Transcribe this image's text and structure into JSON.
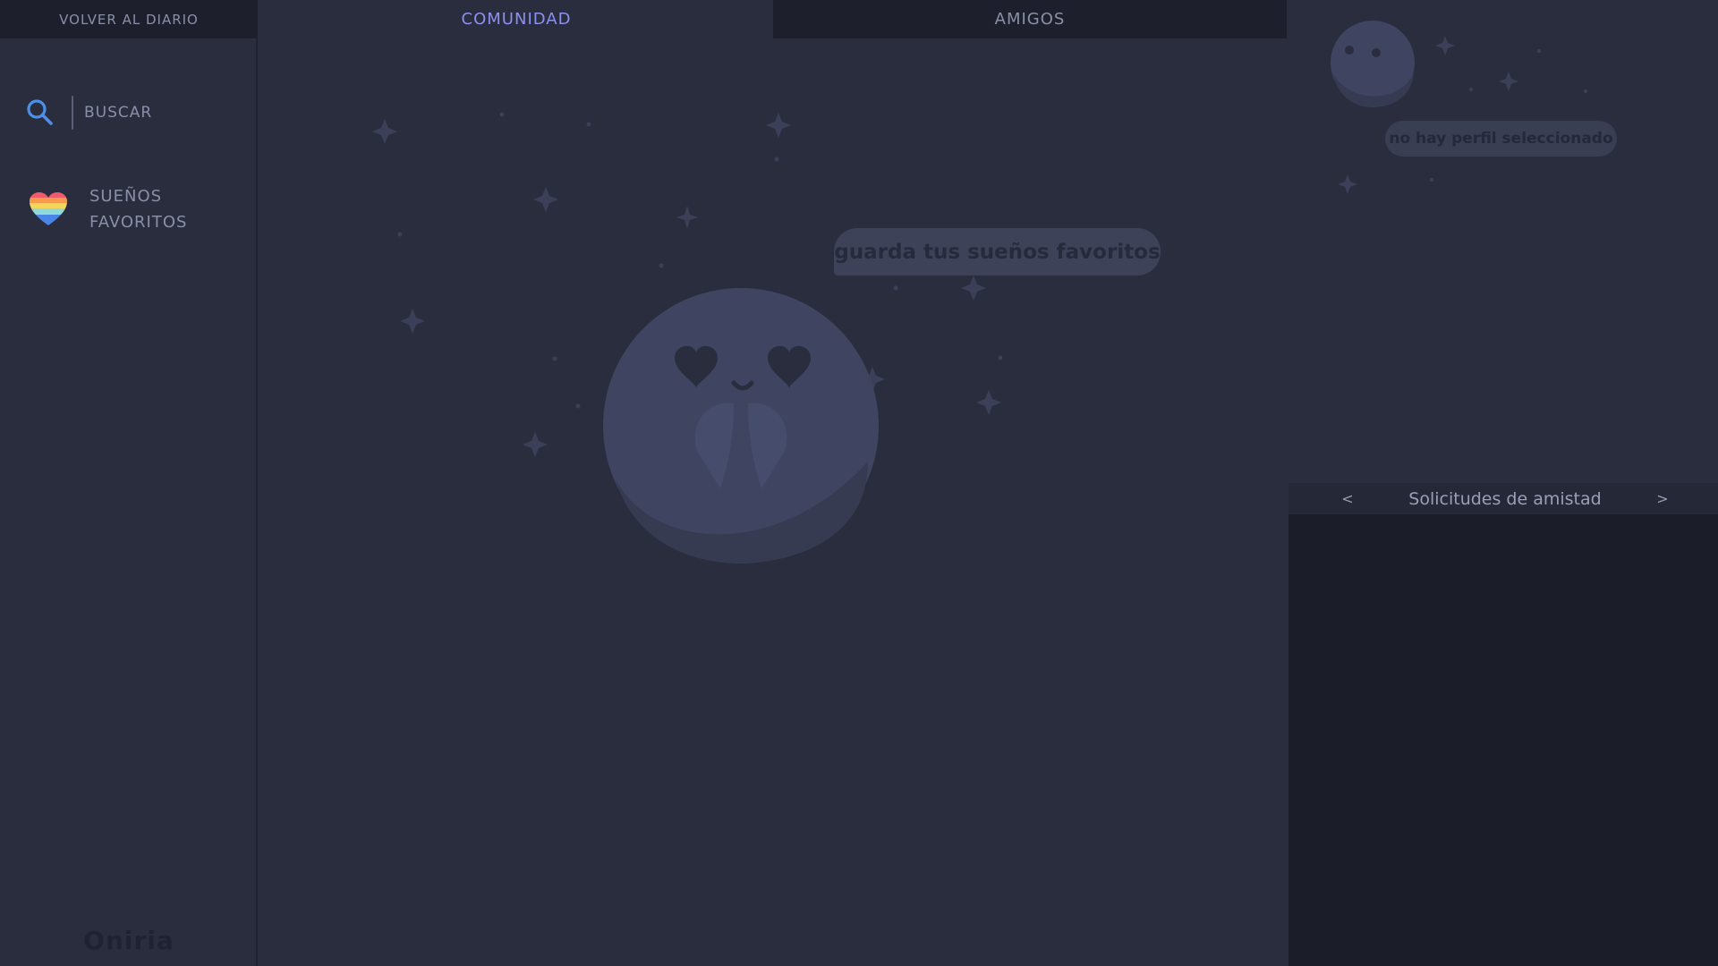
{
  "sidebar": {
    "back_label": "VOLVER AL DIARIO",
    "search_placeholder": "BUSCAR",
    "search_icon": "search-icon",
    "favorites_label": "SUEÑOS FAVORITOS",
    "favorites_icon": "rainbow-heart-icon",
    "brand": "Oniria"
  },
  "tabs": [
    {
      "label": "COMUNIDAD",
      "active": true
    },
    {
      "label": "AMIGOS",
      "active": false
    }
  ],
  "main": {
    "speech_bubble": "guarda tus sueños favoritos",
    "mascot_icon": "moon-mascot-icon"
  },
  "right_panel": {
    "profile_status": "no hay perfil seleccionado",
    "requests_title": "Solicitudes de amistad",
    "prev_label": "<",
    "next_label": ">"
  },
  "colors": {
    "accent": "#8c90ef",
    "background": "#2a2d3e",
    "panel_dark": "#1d202c",
    "muted_text": "#8a8fa8"
  }
}
